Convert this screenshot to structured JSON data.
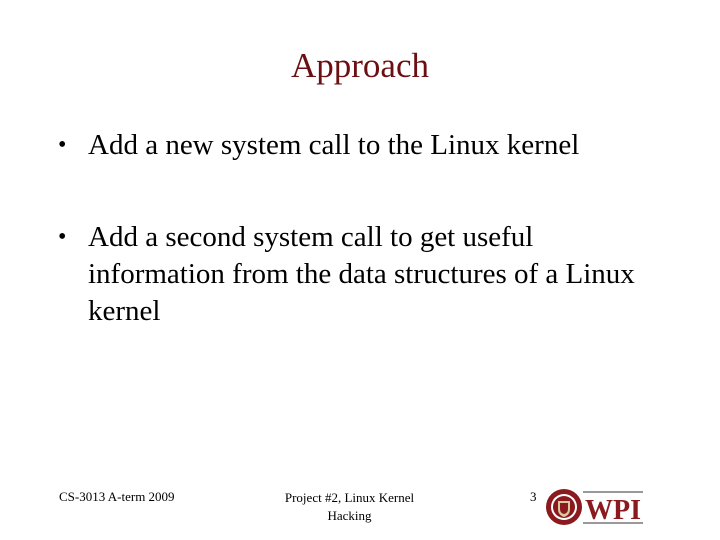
{
  "slide": {
    "title": "Approach",
    "bullets": [
      {
        "text": "Add a new system call to the Linux kernel"
      },
      {
        "text": "Add a second system call to get useful information from the data structures of a Linux kernel"
      }
    ]
  },
  "footer": {
    "course": "CS-3013 A-term 2009",
    "topic": "Project #2, Linux Kernel Hacking",
    "page_number": "3",
    "logo_text": "WPI"
  },
  "colors": {
    "title": "#6b0f12",
    "brand": "#8b1a1f"
  }
}
